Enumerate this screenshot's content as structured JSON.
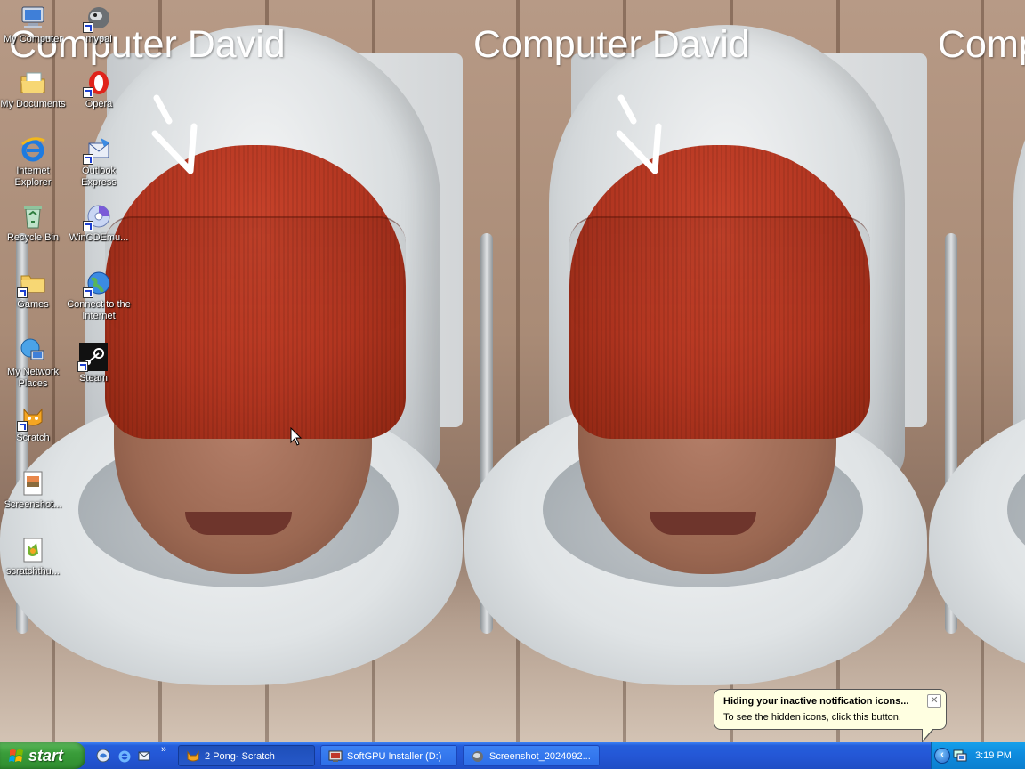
{
  "wallpaper": {
    "caption": "Computer David",
    "tiles": 3
  },
  "desktop_icons": [
    {
      "label": "My Computer",
      "icon": "my-computer-icon",
      "shortcut": false
    },
    {
      "label": "mypal",
      "icon": "mypal-browser-icon",
      "shortcut": true
    },
    {
      "label": "My Documents",
      "icon": "my-documents-icon",
      "shortcut": false
    },
    {
      "label": "Opera",
      "icon": "opera-icon",
      "shortcut": true
    },
    {
      "label": "Internet Explorer",
      "icon": "internet-explorer-icon",
      "shortcut": false
    },
    {
      "label": "Outlook Express",
      "icon": "outlook-express-icon",
      "shortcut": true
    },
    {
      "label": "Recycle Bin",
      "icon": "recycle-bin-icon",
      "shortcut": false
    },
    {
      "label": "WinCDEmu...",
      "icon": "wincdemu-icon",
      "shortcut": true
    },
    {
      "label": "Games",
      "icon": "folder-icon",
      "shortcut": true
    },
    {
      "label": "Connect to the Internet",
      "icon": "connect-internet-icon",
      "shortcut": true
    },
    {
      "label": "My Network Places",
      "icon": "network-places-icon",
      "shortcut": false
    },
    {
      "label": "Steam",
      "icon": "steam-icon",
      "shortcut": true
    },
    {
      "label": "Scratch",
      "icon": "scratch-cat-icon",
      "shortcut": true
    },
    {
      "label": "Screenshot...",
      "icon": "image-file-icon",
      "shortcut": false
    },
    {
      "label": "scratchthu...",
      "icon": "scratch-thumbnail-icon",
      "shortcut": false
    }
  ],
  "taskbar": {
    "start_label": "start",
    "quick_launch_more": "»",
    "tasks": [
      {
        "label": "2 Pong- Scratch",
        "icon": "scratch-cat-icon",
        "active": true
      },
      {
        "label": "SoftGPU Installer (D:)",
        "icon": "installer-icon",
        "active": false
      },
      {
        "label": "Screenshot_2024092...",
        "icon": "image-viewer-icon",
        "active": false
      }
    ],
    "tray": {
      "toggle_glyph": "‹",
      "clock": "3:19 PM"
    }
  },
  "balloon": {
    "title": "Hiding your inactive notification icons...",
    "text": "To see the hidden icons, click this button.",
    "close_glyph": "✕"
  },
  "colors": {
    "taskbar_blue": "#245edb",
    "start_green": "#3a9d3a",
    "tray_blue": "#0f8de0",
    "balloon_bg": "#ffffe1",
    "hat_red": "#b13520"
  }
}
